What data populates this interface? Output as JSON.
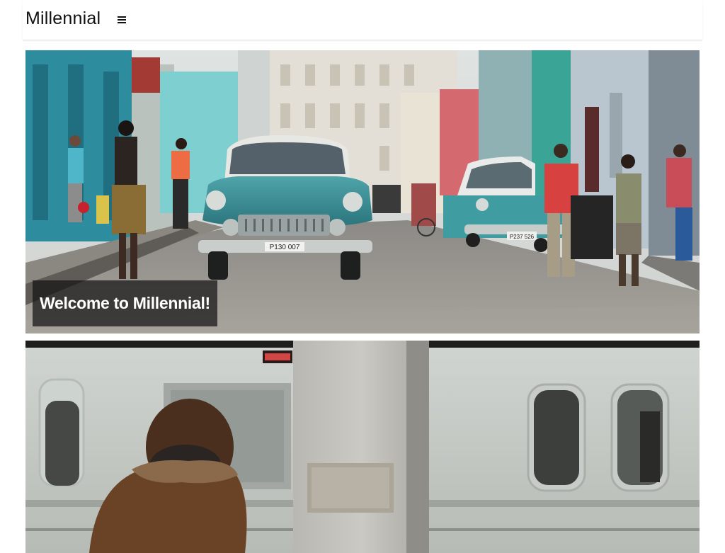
{
  "header": {
    "brand": "Millennial",
    "menu_icon": "hamburger-menu-icon"
  },
  "hero": {
    "caption": "Welcome to Millennial!",
    "plate": "P130 007",
    "plate_2": "P237 526"
  },
  "colors": {
    "caption_bg": "#141414",
    "car_teal": "#3a8d96",
    "wall_turquoise": "#55b9b3"
  }
}
